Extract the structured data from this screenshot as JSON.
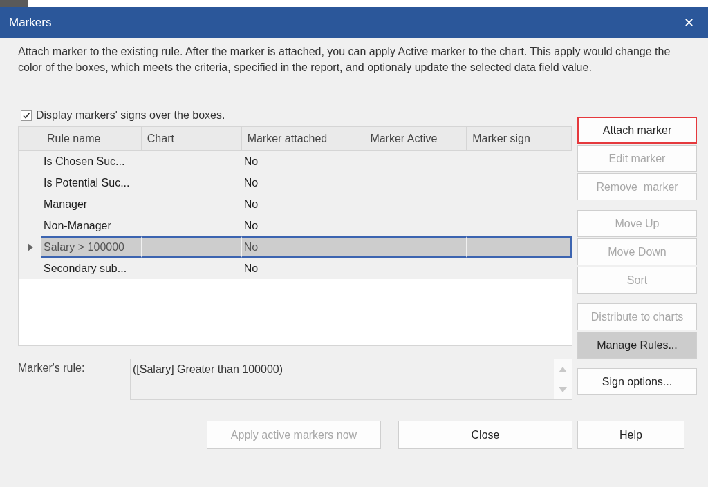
{
  "window": {
    "title": "Markers",
    "close_glyph": "✕"
  },
  "description": "Attach marker to the existing rule. After the marker is attached, you can apply Active marker to the chart. This apply would change the color of the boxes, which meets the criteria, specified in the report, and optionaly update the selected data field value.",
  "display_signs": {
    "label": "Display markers' signs over the boxes.",
    "checked": true
  },
  "table": {
    "columns": [
      "Rule name",
      "Chart",
      "Marker attached",
      "Marker Active",
      "Marker sign"
    ],
    "rows": [
      {
        "rule_name": "Is Chosen Suc...",
        "marker_attached": "No",
        "selected": false
      },
      {
        "rule_name": "Is Potential Suc...",
        "marker_attached": "No",
        "selected": false
      },
      {
        "rule_name": "Manager",
        "marker_attached": "No",
        "selected": false
      },
      {
        "rule_name": "Non-Manager",
        "marker_attached": "No",
        "selected": false
      },
      {
        "rule_name": "Salary > 100000",
        "marker_attached": "No",
        "selected": true
      },
      {
        "rule_name": "Secondary sub...",
        "marker_attached": "No",
        "selected": false
      }
    ]
  },
  "markers_rule": {
    "label": "Marker's rule:",
    "value": "([Salary] Greater than 100000)"
  },
  "button_groups": [
    {
      "buttons": [
        {
          "label": "Attach marker",
          "disabled": false,
          "focused": true,
          "highlighted": false
        },
        {
          "label": "Edit marker",
          "disabled": true,
          "focused": false,
          "highlighted": false
        },
        {
          "label": "Remove  marker",
          "disabled": true,
          "focused": false,
          "highlighted": false
        }
      ]
    },
    {
      "buttons": [
        {
          "label": "Move Up",
          "disabled": true,
          "focused": false,
          "highlighted": false
        },
        {
          "label": "Move Down",
          "disabled": true,
          "focused": false,
          "highlighted": false
        },
        {
          "label": "Sort",
          "disabled": true,
          "focused": false,
          "highlighted": false
        }
      ]
    },
    {
      "buttons": [
        {
          "label": "Distribute to charts",
          "disabled": true,
          "focused": false,
          "highlighted": false
        },
        {
          "label": "Manage Rules...",
          "disabled": false,
          "focused": false,
          "highlighted": true
        }
      ]
    },
    {
      "buttons": [
        {
          "label": "Sign options...",
          "disabled": false,
          "focused": false,
          "highlighted": false
        }
      ]
    }
  ],
  "bottom_buttons": [
    {
      "label": "Apply active markers now",
      "disabled": true
    },
    {
      "label": "Close",
      "disabled": false
    },
    {
      "label": "Help",
      "disabled": false
    }
  ]
}
